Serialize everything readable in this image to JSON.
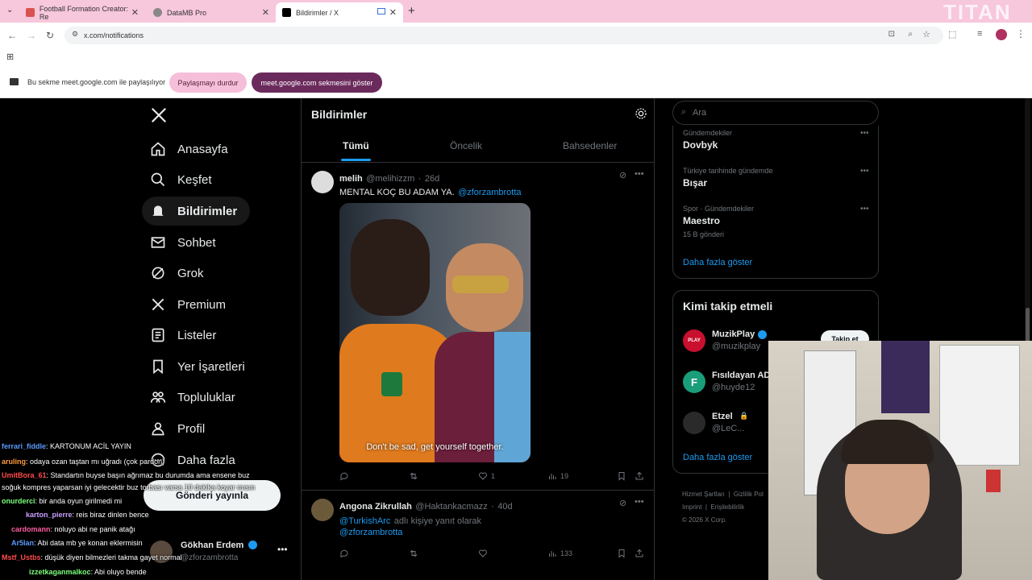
{
  "browser": {
    "tabs": [
      {
        "label": "Football Formation Creator: Re"
      },
      {
        "label": "DataMB Pro"
      },
      {
        "label": "Bildirimler / X"
      }
    ],
    "url": "x.com/notifications",
    "share_notice": "Bu sekme meet.google.com ile paylaşılıyor",
    "stop_sharing": "Paylaşmayı durdur",
    "show_tab": "meet.google.com sekmesini göster"
  },
  "sidebar": {
    "items": [
      {
        "label": "Anasayfa",
        "icon": "home-icon"
      },
      {
        "label": "Keşfet",
        "icon": "search-icon"
      },
      {
        "label": "Bildirimler",
        "icon": "bell-icon"
      },
      {
        "label": "Sohbet",
        "icon": "mail-icon"
      },
      {
        "label": "Grok",
        "icon": "grok-icon"
      },
      {
        "label": "Premium",
        "icon": "x-icon"
      },
      {
        "label": "Listeler",
        "icon": "list-icon"
      },
      {
        "label": "Yer İşaretleri",
        "icon": "bookmark-icon"
      },
      {
        "label": "Topluluklar",
        "icon": "people-icon"
      },
      {
        "label": "Profil",
        "icon": "person-icon"
      },
      {
        "label": "Daha fazla",
        "icon": "more-icon"
      }
    ],
    "post_button": "Gönderi yayınla",
    "account": {
      "name": "Gökhan Erdem",
      "handle": "@zforzambrotta"
    }
  },
  "feed": {
    "title": "Bildirimler",
    "tabs": [
      "Tümü",
      "Öncelik",
      "Bahsedenler"
    ],
    "tweets": [
      {
        "name": "melih",
        "handle": "@melihizzm",
        "time": "26d",
        "text": "MENTAL KOÇ BU ADAM YA.",
        "mention": "@zforzambrotta",
        "caption": "Don't be sad, get yourself together.",
        "likes": "1",
        "views": "19"
      },
      {
        "name": "Angona Zikrullah",
        "handle": "@Haktankacmazz",
        "time": "40d",
        "mention1": "@TurkishArc",
        "text": "adlı kişiye yanıt olarak",
        "mention2": "@zforzambrotta",
        "views": "133"
      }
    ]
  },
  "right": {
    "search_placeholder": "Ara",
    "trends": [
      {
        "category": "Gündemdekiler",
        "name": "Dovbyk",
        "posts": ""
      },
      {
        "category": "Türkiye tarihinde gündemde",
        "name": "Bışar",
        "posts": ""
      },
      {
        "category": "Spor · Gündemdekiler",
        "name": "Maestro",
        "posts": "15 B gönderi"
      }
    ],
    "show_more": "Daha fazla göster",
    "who_to_follow_title": "Kimi takip etmeli",
    "follow_suggestions": [
      {
        "name": "MuzikPlay",
        "handle": "@muzikplay"
      },
      {
        "name": "Fısıldayan AD",
        "handle": "@huyde12"
      },
      {
        "name": "Etzel",
        "handle": "@LeC..."
      }
    ],
    "follow_button": "Takip et",
    "show_more2": "Daha fazla göster",
    "footer": [
      "Hizmet Şartları",
      "Gizlilik Pol",
      "Imprint",
      "Erişilebilirlik",
      "© 2026 X Corp."
    ]
  },
  "chat": [
    {
      "user": "ferrari_fiddle",
      "msg": ": KARTONUM ACİL YAYIN",
      "color": "#5b9bff"
    },
    {
      "user": "aruling",
      "msg": ": odaya ozan taştan mı uğradı (çok pardon)",
      "color": "#ff9c3f"
    },
    {
      "user": "UmitBora_61",
      "msg": ": Standartın buyse başın ağrımaz bu durumda ama ensene buz",
      "color": "#ff4b4b"
    },
    {
      "user": "",
      "msg": "soğuk kompres yaparsan iyi gelecektir buz torbası varsa 10 dakika koyar mısın",
      "color": "#ff4b4b"
    },
    {
      "user": "onurderci",
      "msg": ": bir anda oyun girilmedi mi",
      "color": "#7cff7c"
    },
    {
      "user": "karton_pierre",
      "msg": ": reis biraz dinlen bence",
      "color": "#c8a0ff"
    },
    {
      "user": "cardomann",
      "msg": ": noluyo abi ne panik atağı",
      "color": "#ff5da2"
    },
    {
      "user": "Ar5lan",
      "msg": ": Abi data mb ye konan eklermisin",
      "color": "#5b9bff"
    },
    {
      "user": "Mstf_Ustbs",
      "msg": ": düşük diyen bilmezleri takma gayet normal",
      "color": "#ff4b4b"
    },
    {
      "user": "izzetkaganmalkoc",
      "msg": ": Abi oluyo bende",
      "color": "#7cff7c"
    }
  ],
  "watermark": "TITAN",
  "colors": {
    "accent": "#1d9bf0",
    "tab_strip": "#f7c7dc",
    "purple_button": "#6b2a5c"
  }
}
